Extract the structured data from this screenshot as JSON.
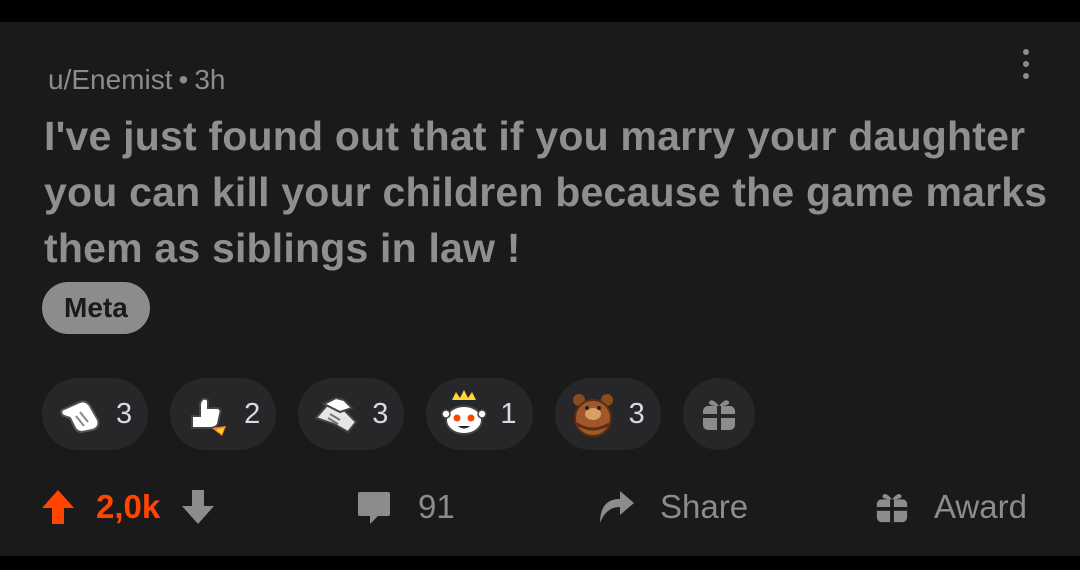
{
  "post": {
    "author": "u/Enemist",
    "separator": "•",
    "age": "3h",
    "title": "I've just found out that if you marry your daughter you can kill your children because the game marks them as siblings in law !",
    "flair": "Meta"
  },
  "awards": [
    {
      "icon": "pointing-hand-award-icon",
      "count": "3"
    },
    {
      "icon": "rocket-like-award-icon",
      "count": "2"
    },
    {
      "icon": "handshake-award-icon",
      "count": "3"
    },
    {
      "icon": "snoo-wholesome-award-icon",
      "count": "1"
    },
    {
      "icon": "bear-hug-award-icon",
      "count": "3"
    }
  ],
  "actions": {
    "score": "2,0k",
    "comments": "91",
    "share_label": "Share",
    "award_label": "Award"
  },
  "colors": {
    "upvote": "#ff4500",
    "background": "#1a1a1b",
    "muted_text": "#8c8c8e"
  }
}
